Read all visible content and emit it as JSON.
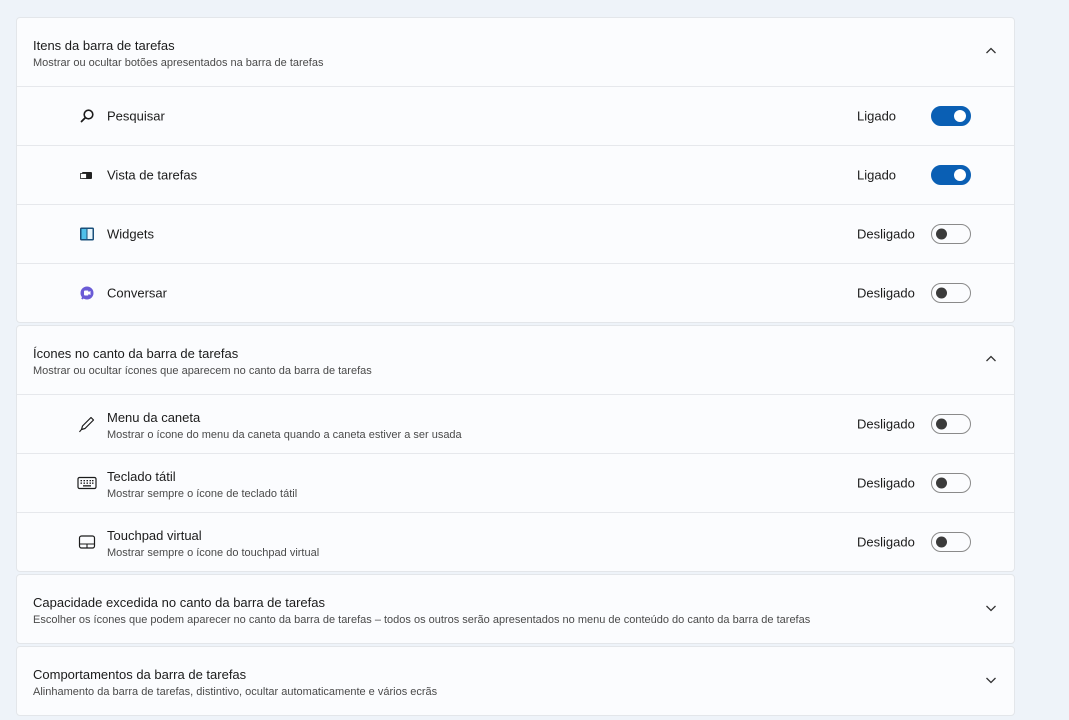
{
  "sections": [
    {
      "title": "Itens da barra de tarefas",
      "subtitle": "Mostrar ou ocultar botões apresentados na barra de tarefas",
      "expanded": true,
      "items": [
        {
          "icon": "search-icon",
          "label": "Pesquisar",
          "state": "Ligado",
          "on": true
        },
        {
          "icon": "task-view-icon",
          "label": "Vista de tarefas",
          "state": "Ligado",
          "on": true
        },
        {
          "icon": "widgets-icon",
          "label": "Widgets",
          "state": "Desligado",
          "on": false
        },
        {
          "icon": "chat-icon",
          "label": "Conversar",
          "state": "Desligado",
          "on": false
        }
      ]
    },
    {
      "title": "Ícones no canto da barra de tarefas",
      "subtitle": "Mostrar ou ocultar ícones que aparecem no canto da barra de tarefas",
      "expanded": true,
      "items": [
        {
          "icon": "pen-icon",
          "label": "Menu da caneta",
          "description": "Mostrar o ícone do menu da caneta quando a caneta estiver a ser usada",
          "state": "Desligado",
          "on": false
        },
        {
          "icon": "keyboard-icon",
          "label": "Teclado tátil",
          "description": "Mostrar sempre o ícone de teclado tátil",
          "state": "Desligado",
          "on": false
        },
        {
          "icon": "touchpad-icon",
          "label": "Touchpad virtual",
          "description": "Mostrar sempre o ícone do touchpad virtual",
          "state": "Desligado",
          "on": false
        }
      ]
    },
    {
      "title": "Capacidade excedida no canto da barra de tarefas",
      "subtitle": "Escolher os ícones que podem aparecer no canto da barra de tarefas – todos os outros serão apresentados no menu de conteúdo do canto da barra de tarefas",
      "expanded": false
    },
    {
      "title": "Comportamentos da barra de tarefas",
      "subtitle": "Alinhamento da barra de tarefas, distintivo, ocultar automaticamente e vários ecrãs",
      "expanded": false
    }
  ],
  "colors": {
    "accent": "#0a5fb4",
    "background": "#eef3f9",
    "panel": "#fbfcfe"
  }
}
